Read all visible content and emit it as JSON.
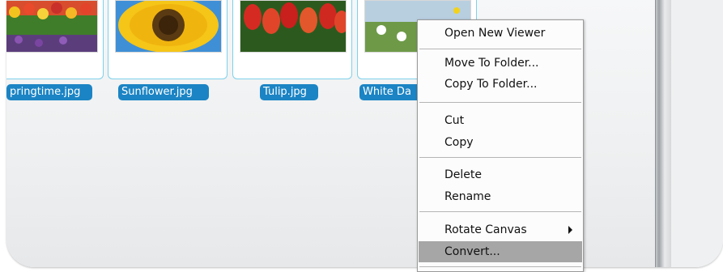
{
  "thumbnails": [
    {
      "name": "Springtime.jpg",
      "label": "pringtime.jpg"
    },
    {
      "name": "Sunflower.jpg",
      "label": "Sunflower.jpg"
    },
    {
      "name": "Tulip.jpg",
      "label": "Tulip.jpg"
    },
    {
      "name": "White Daisies.jpg",
      "label": "White Da"
    }
  ],
  "menu": {
    "items": [
      {
        "label": "Open New Viewer"
      },
      {
        "label": "Move To Folder..."
      },
      {
        "label": "Copy To Folder..."
      },
      {
        "label": "Cut"
      },
      {
        "label": "Copy"
      },
      {
        "label": "Delete"
      },
      {
        "label": "Rename"
      },
      {
        "label": "Rotate Canvas",
        "submenu": true
      },
      {
        "label": "Convert...",
        "highlighted": true
      }
    ]
  },
  "colors": {
    "label_bg": "#1b84c4",
    "thumb_border": "#7fd0ea",
    "menu_highlight": "#a6a6a6"
  }
}
